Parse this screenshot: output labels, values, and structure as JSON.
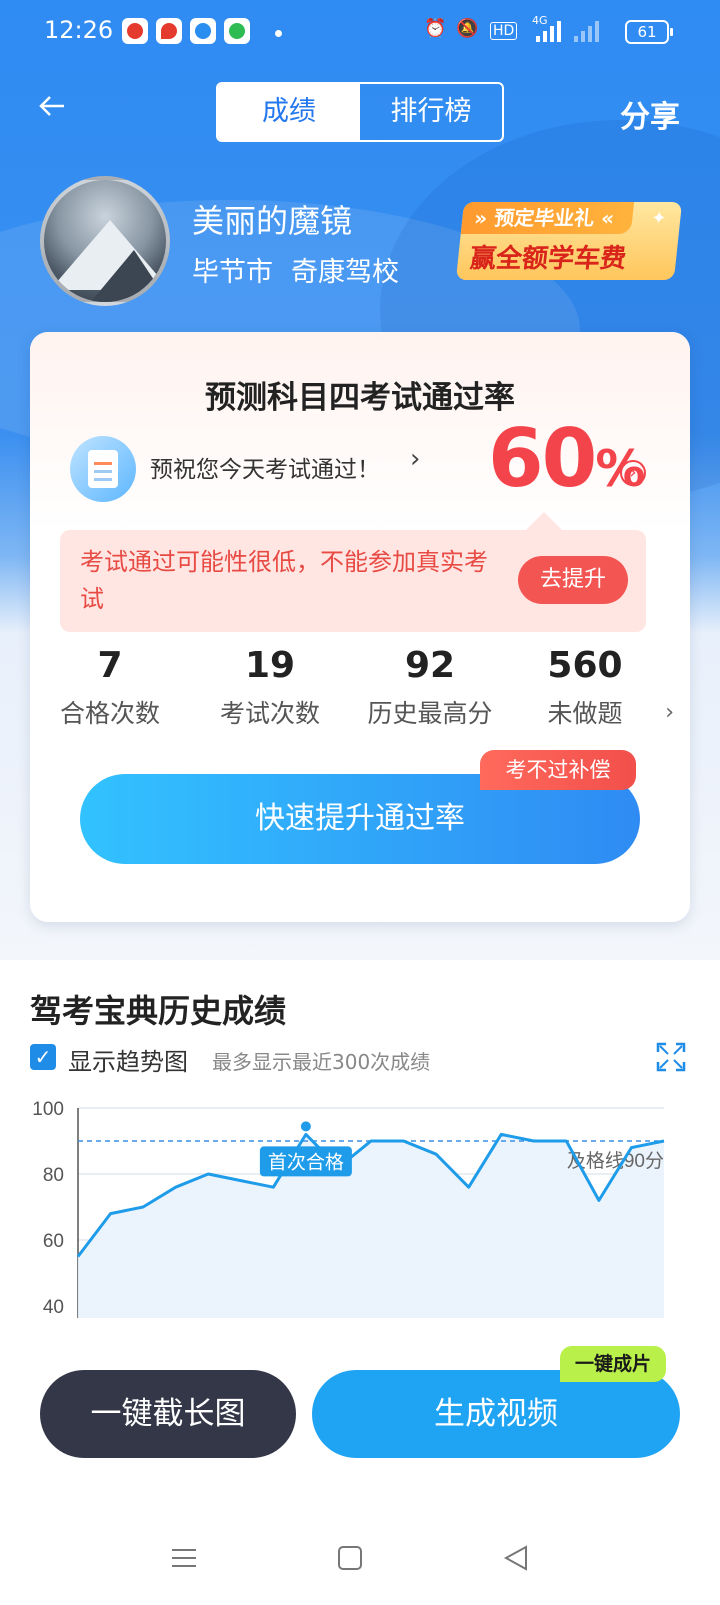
{
  "status_bar": {
    "time": "12:26",
    "battery": "61",
    "hd": "HD",
    "net": "4G"
  },
  "header": {
    "tabs": [
      {
        "label": "成绩",
        "active": true
      },
      {
        "label": "排行榜",
        "active": false
      }
    ],
    "share": "分享"
  },
  "profile": {
    "name": "美丽的魔镜",
    "city": "毕节市",
    "school": "奇康驾校"
  },
  "promo": {
    "top": "预定毕业礼",
    "main": "赢全额学车费"
  },
  "card": {
    "title": "预测科目四考试通过率",
    "wish": "预祝您今天考试通过！",
    "rate_value": "60",
    "rate_unit": "%",
    "warning": "考试通过可能性很低，不能参加真实考试",
    "improve_button": "去提升",
    "stats": [
      {
        "value": "7",
        "label": "合格次数"
      },
      {
        "value": "19",
        "label": "考试次数"
      },
      {
        "value": "92",
        "label": "历史最高分"
      },
      {
        "value": "560",
        "label": "未做题"
      }
    ],
    "cta": "快速提升通过率",
    "cta_tag": "考不过补偿"
  },
  "history": {
    "title": "驾考宝典历史成绩",
    "show_trend": "显示趋势图",
    "note": "最多显示最近300次成绩",
    "first_pass": "首次合格",
    "pass_line_label": "及格线90分"
  },
  "chart_data": {
    "type": "area",
    "y_ticks": [
      "100",
      "80",
      "60",
      "40"
    ],
    "ylim": [
      40,
      100
    ],
    "pass_line": 90,
    "values": [
      55,
      68,
      70,
      76,
      80,
      78,
      76,
      92,
      82,
      90,
      90,
      86,
      76,
      92,
      90,
      90,
      72,
      88,
      90
    ],
    "first_pass_index": 7,
    "color": "#1e9be9"
  },
  "actions": {
    "screenshot": "一键截长图",
    "video": "生成视频",
    "video_tag": "一键成片"
  }
}
